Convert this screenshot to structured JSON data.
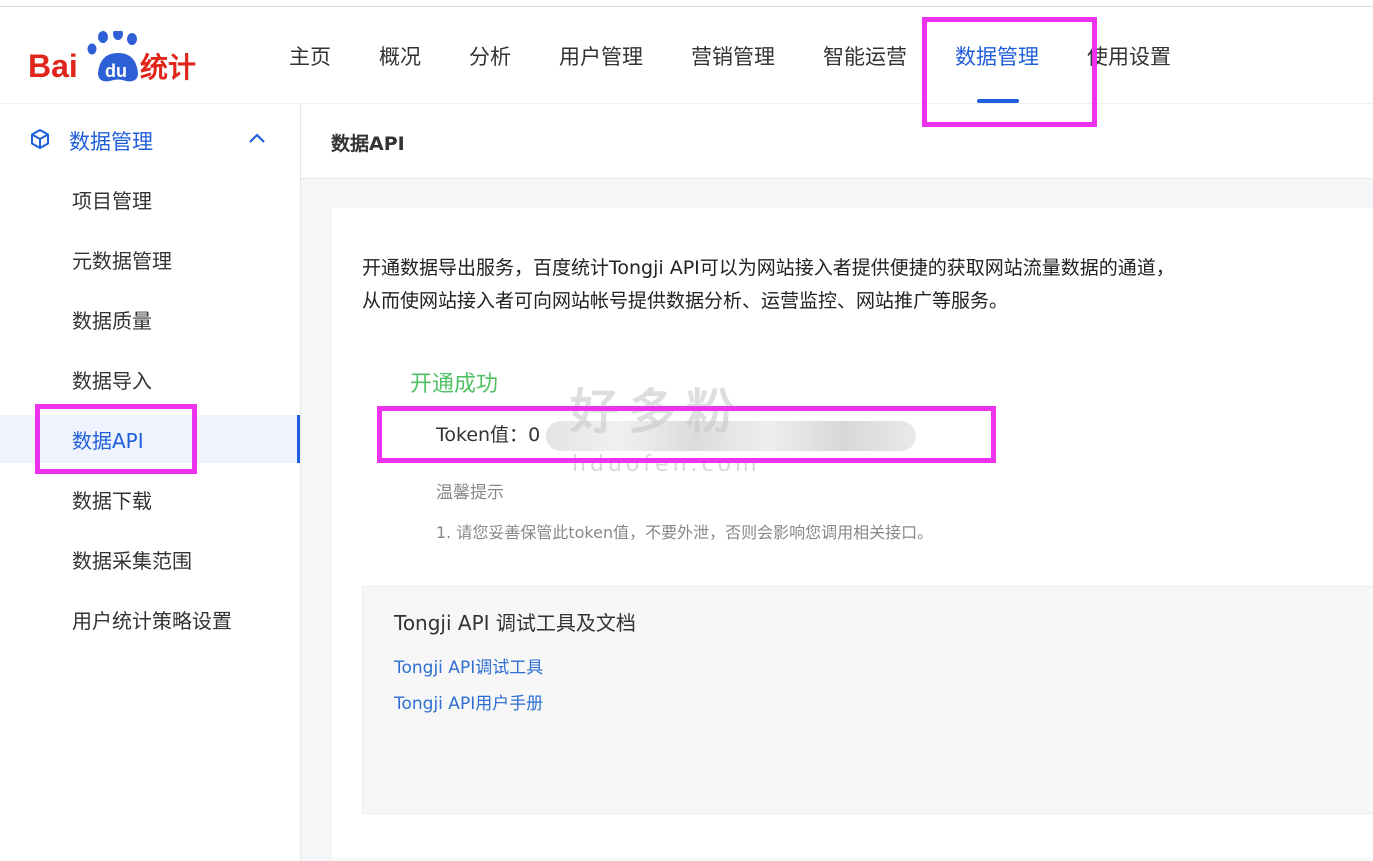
{
  "header": {
    "logo": {
      "bai": "Bai",
      "du": "du",
      "tongji": "统计"
    },
    "nav": [
      {
        "label": "主页",
        "active": false
      },
      {
        "label": "概况",
        "active": false
      },
      {
        "label": "分析",
        "active": false
      },
      {
        "label": "用户管理",
        "active": false
      },
      {
        "label": "营销管理",
        "active": false
      },
      {
        "label": "智能运营",
        "active": false
      },
      {
        "label": "数据管理",
        "active": true
      },
      {
        "label": "使用设置",
        "active": false
      }
    ]
  },
  "sidebar": {
    "group_label": "数据管理",
    "items": [
      {
        "label": "项目管理"
      },
      {
        "label": "元数据管理"
      },
      {
        "label": "数据质量"
      },
      {
        "label": "数据导入"
      },
      {
        "label": "数据API",
        "active": true
      },
      {
        "label": "数据下载"
      },
      {
        "label": "数据采集范围"
      },
      {
        "label": "用户统计策略设置"
      }
    ]
  },
  "content": {
    "title": "数据API",
    "intro_line1": "开通数据导出服务，百度统计Tongji API可以为网站接入者提供便捷的获取网站流量数据的通道，",
    "intro_line2": "从而使网站接入者可向网站帐号提供数据分析、运营监控、网站推广等服务。",
    "status": "开通成功",
    "token_label": "Token值：",
    "token_value_prefix": "0",
    "tips_title": "温馨提示",
    "tips_text": "1. 请您妥善保管此token值，不要外泄，否则会影响您调用相关接口。",
    "tools": {
      "title": "Tongji API 调试工具及文档",
      "link_debug": "Tongji API调试工具",
      "link_manual": "Tongji API用户手册"
    }
  },
  "watermark": {
    "big": "好多粉",
    "small": "hduofen.com"
  },
  "colors": {
    "accent": "#1f5fdb",
    "success": "#52c267",
    "annotation": "#ee33ee",
    "link": "#2e6fd1"
  }
}
